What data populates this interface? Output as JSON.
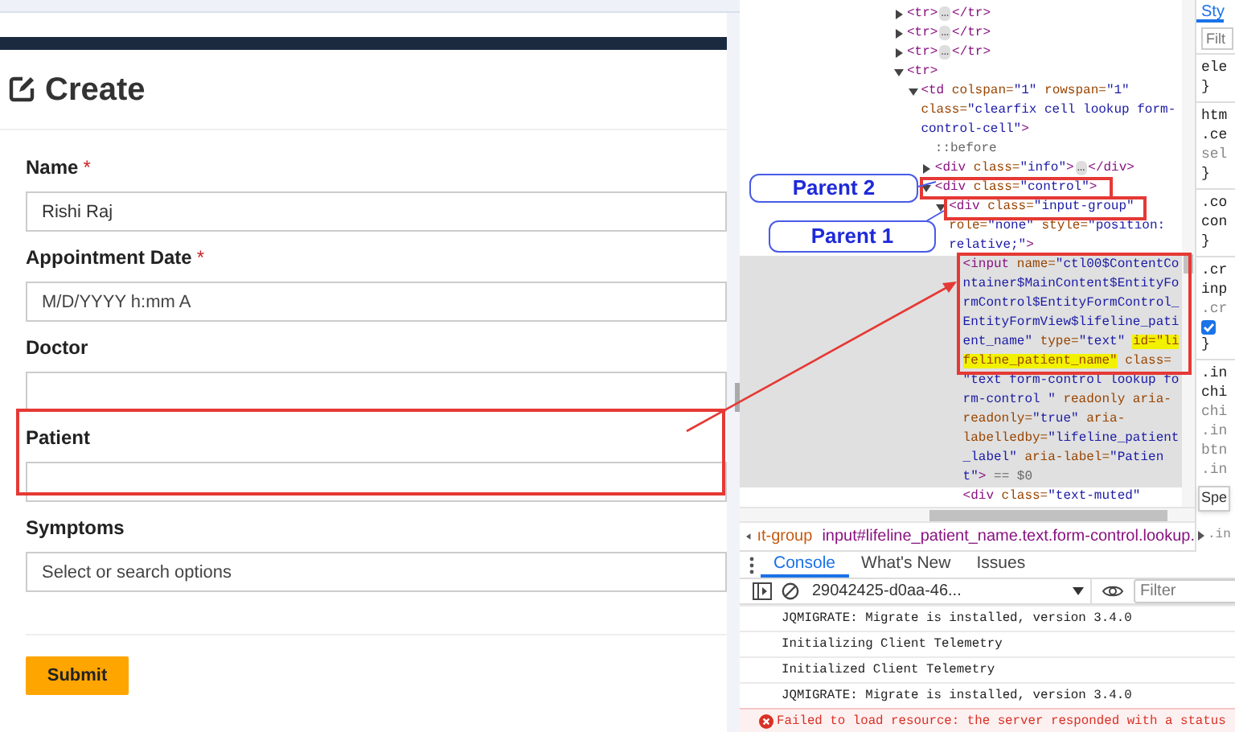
{
  "page": {
    "heading": "Create",
    "fields": [
      {
        "label": "Name",
        "required_mark": "*",
        "value": "Rishi Raj"
      },
      {
        "label": "Appointment Date",
        "required_mark": "*",
        "placeholder": "M/D/YYYY h:mm A"
      },
      {
        "label": "Doctor"
      },
      {
        "label": "Patient"
      },
      {
        "label": "Symptoms",
        "placeholder": "Select or search options"
      }
    ],
    "submit": "Submit"
  },
  "annotations": {
    "callouts": [
      {
        "label": "Parent 2"
      },
      {
        "label": "Parent 1"
      }
    ]
  },
  "elements_tree": [
    {
      "expanded": false,
      "selected": false,
      "lines": [
        [
          {
            "kind": "tag",
            "text": "<tr>"
          },
          {
            "kind": "ellipsis",
            "text": "…"
          },
          {
            "kind": "tag",
            "text": "</tr>"
          }
        ]
      ]
    },
    {
      "expanded": false,
      "selected": false,
      "lines": [
        [
          {
            "kind": "tag",
            "text": "<tr>"
          },
          {
            "kind": "ellipsis",
            "text": "…"
          },
          {
            "kind": "tag",
            "text": "</tr>"
          }
        ]
      ]
    },
    {
      "expanded": false,
      "selected": false,
      "lines": [
        [
          {
            "kind": "tag",
            "text": "<tr>"
          },
          {
            "kind": "ellipsis",
            "text": "…"
          },
          {
            "kind": "tag",
            "text": "</tr>"
          }
        ]
      ]
    },
    {
      "expanded": true,
      "selected": false,
      "lines": [
        [
          {
            "kind": "tag",
            "text": "<tr>"
          }
        ]
      ],
      "children": [
        {
          "expanded": true,
          "selected": false,
          "lines": [
            [
              {
                "kind": "tag",
                "text": "<td"
              },
              {
                "kind": "attr",
                "text": " colspan="
              },
              {
                "kind": "value",
                "text": "\"1\""
              },
              {
                "kind": "attr",
                "text": " rowspan="
              },
              {
                "kind": "value",
                "text": "\"1\""
              }
            ],
            [
              {
                "kind": "attr",
                "text": "class="
              },
              {
                "kind": "value",
                "text": "\"clearfix cell lookup form-"
              }
            ],
            [
              {
                "kind": "value",
                "text": "control-cell\""
              },
              {
                "kind": "tag",
                "text": ">"
              }
            ]
          ],
          "children": [
            {
              "selected": false,
              "lines": [
                [
                  {
                    "kind": "pseudo",
                    "text": "::before"
                  }
                ]
              ]
            },
            {
              "expanded": false,
              "selected": false,
              "lines": [
                [
                  {
                    "kind": "tag",
                    "text": "<div"
                  },
                  {
                    "kind": "attr",
                    "text": " class="
                  },
                  {
                    "kind": "value",
                    "text": "\"info\""
                  },
                  {
                    "kind": "tag",
                    "text": ">"
                  },
                  {
                    "kind": "ellipsis",
                    "text": "…"
                  },
                  {
                    "kind": "tag",
                    "text": "</div>"
                  }
                ]
              ]
            },
            {
              "expanded": true,
              "selected": false,
              "lines": [
                [
                  {
                    "kind": "tag",
                    "text": "<div"
                  },
                  {
                    "kind": "attr",
                    "text": " class="
                  },
                  {
                    "kind": "value",
                    "text": "\"control\""
                  },
                  {
                    "kind": "tag",
                    "text": ">"
                  }
                ]
              ],
              "children": [
                {
                  "expanded": true,
                  "selected": false,
                  "lines": [
                    [
                      {
                        "kind": "tag",
                        "text": "<div"
                      },
                      {
                        "kind": "attr",
                        "text": " class="
                      },
                      {
                        "kind": "value",
                        "text": "\"input-group\""
                      }
                    ],
                    [
                      {
                        "kind": "attr",
                        "text": "role="
                      },
                      {
                        "kind": "value",
                        "text": "\"none\""
                      },
                      {
                        "kind": "attr",
                        "text": " style="
                      },
                      {
                        "kind": "value",
                        "text": "\"position:"
                      }
                    ],
                    [
                      {
                        "kind": "value",
                        "text": "relative;\""
                      },
                      {
                        "kind": "tag",
                        "text": ">"
                      }
                    ]
                  ],
                  "children": [
                    {
                      "selected": true,
                      "lines": [
                        [
                          {
                            "kind": "tag",
                            "text": "<input"
                          },
                          {
                            "kind": "attr",
                            "text": " name="
                          },
                          {
                            "kind": "value",
                            "text": "\"ctl00$ContentCo"
                          }
                        ],
                        [
                          {
                            "kind": "value",
                            "text": "ntainer$MainContent$EntityFo"
                          }
                        ],
                        [
                          {
                            "kind": "value",
                            "text": "rmControl$EntityFormControl_"
                          }
                        ],
                        [
                          {
                            "kind": "value",
                            "text": "EntityFormView$lifeline_pati"
                          }
                        ],
                        [
                          {
                            "kind": "value",
                            "text": "ent_name\""
                          },
                          {
                            "kind": "attr",
                            "text": " type="
                          },
                          {
                            "kind": "value",
                            "text": "\"text\" "
                          },
                          {
                            "kind": "match",
                            "text": "id=\"li"
                          }
                        ],
                        [
                          {
                            "kind": "match",
                            "text": "feline_patient_name\""
                          },
                          {
                            "kind": "attr",
                            "text": " class="
                          }
                        ],
                        [
                          {
                            "kind": "value",
                            "text": "\"text form-control lookup fo"
                          }
                        ],
                        [
                          {
                            "kind": "value",
                            "text": "rm-control \""
                          },
                          {
                            "kind": "attr",
                            "text": " readonly aria-"
                          }
                        ],
                        [
                          {
                            "kind": "attr",
                            "text": "readonly="
                          },
                          {
                            "kind": "value",
                            "text": "\"true\""
                          },
                          {
                            "kind": "attr",
                            "text": " aria-"
                          }
                        ],
                        [
                          {
                            "kind": "attr",
                            "text": "labelledby="
                          },
                          {
                            "kind": "value",
                            "text": "\"lifeline_patient"
                          }
                        ],
                        [
                          {
                            "kind": "value",
                            "text": "_label\""
                          },
                          {
                            "kind": "attr",
                            "text": " aria-label="
                          },
                          {
                            "kind": "value",
                            "text": "\"Patien"
                          }
                        ],
                        [
                          {
                            "kind": "value",
                            "text": "t\""
                          },
                          {
                            "kind": "tag",
                            "text": ">"
                          },
                          {
                            "kind": "plain",
                            "text": " == $0"
                          }
                        ]
                      ]
                    },
                    {
                      "selected": false,
                      "lines": [
                        [
                          {
                            "kind": "tag",
                            "text": "<div"
                          },
                          {
                            "kind": "attr",
                            "text": " class="
                          },
                          {
                            "kind": "value",
                            "text": "\"text-muted\""
                          }
                        ]
                      ]
                    }
                  ]
                }
              ]
            }
          ]
        }
      ]
    }
  ],
  "breadcrumbs": [
    {
      "text": "ıt-group",
      "selected": false
    },
    {
      "text": "input#lifeline_patient_name.text.form-control.lookup.",
      "selected": true
    }
  ],
  "breadcrumb_overflow": ".in",
  "styles_pane": {
    "tab": "Sty",
    "filter_placeholder": "Filt",
    "rules": [
      {
        "lines": [
          {
            "kind": "selector",
            "text": "ele"
          },
          {
            "kind": "brace",
            "text": "}"
          }
        ]
      },
      {
        "lines": [
          {
            "kind": "selector",
            "text": "htm"
          },
          {
            "kind": "selector",
            "text": ".ce"
          },
          {
            "kind": "source",
            "text": "sel"
          },
          {
            "kind": "brace",
            "text": "}"
          }
        ]
      },
      {
        "lines": [
          {
            "kind": "selector",
            "text": ".co"
          },
          {
            "kind": "selector",
            "text": "con"
          },
          {
            "kind": "brace",
            "text": "}"
          }
        ]
      },
      {
        "lines": [
          {
            "kind": "selector",
            "text": ".cr"
          },
          {
            "kind": "selector",
            "text": "inp"
          },
          {
            "kind": "source",
            "text": ".cr"
          },
          {
            "kind": "checkbox",
            "checked": true
          },
          {
            "kind": "brace",
            "text": "}"
          }
        ]
      },
      {
        "lines": [
          {
            "kind": "selector",
            "text": ".in"
          },
          {
            "kind": "selector",
            "text": "chi"
          },
          {
            "kind": "source",
            "text": "chi"
          },
          {
            "kind": "source",
            "text": ".in"
          },
          {
            "kind": "source",
            "text": "btn"
          },
          {
            "kind": "source",
            "text": ".in"
          }
        ]
      }
    ],
    "tooltip": "Spe"
  },
  "drawer_tabs": [
    {
      "label": "Console",
      "selected": true
    },
    {
      "label": "What's New",
      "selected": false
    },
    {
      "label": "Issues",
      "selected": false
    }
  ],
  "console": {
    "context": "29042425-d0aa-46...",
    "filter_placeholder": "Filter",
    "messages": [
      {
        "kind": "log",
        "text": "JQMIGRATE: Migrate is installed, version 3.4.0"
      },
      {
        "kind": "log",
        "text": "Initializing Client Telemetry"
      },
      {
        "kind": "log",
        "text": "Initialized Client Telemetry"
      },
      {
        "kind": "log",
        "text": "JQMIGRATE: Migrate is installed, version 3.4.0"
      },
      {
        "kind": "error",
        "text": "Failed to load resource: the server responded with a status"
      }
    ]
  }
}
